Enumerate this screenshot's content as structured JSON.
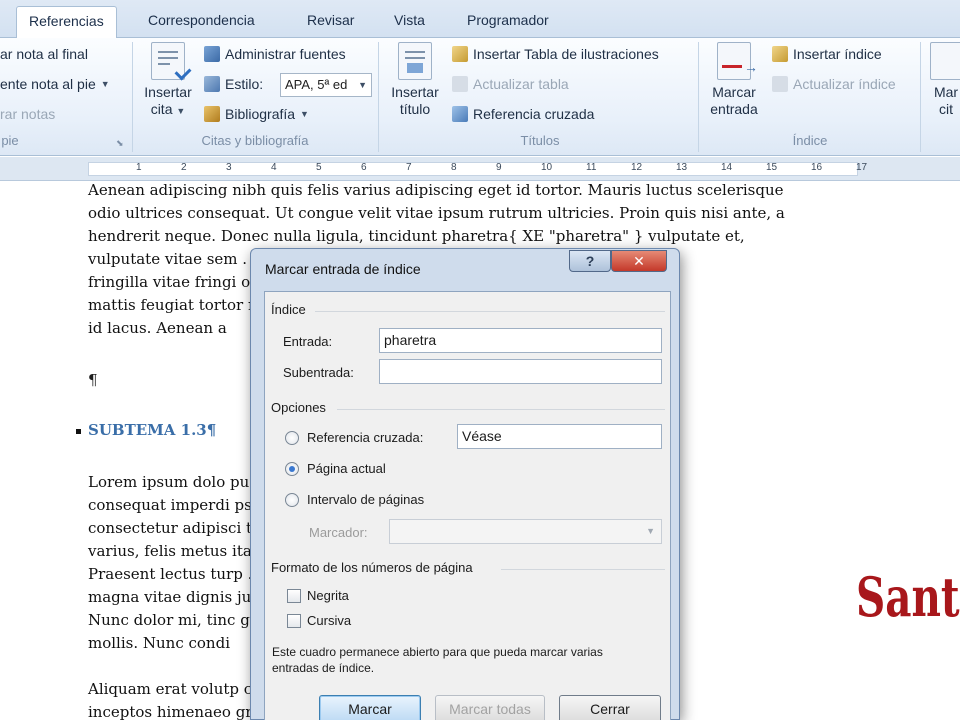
{
  "ribbon": {
    "tabs": [
      "Referencias",
      "Correspondencia",
      "Revisar",
      "Vista",
      "Programador"
    ],
    "active_tab": "Referencias",
    "footnotes": {
      "insert_endnote": "ar nota al final",
      "next_footnote": "ente nota al pie",
      "show_notes": "rar notas",
      "group_label": "pie"
    },
    "citations": {
      "insert_citation": "Insertar cita",
      "manage_sources": "Administrar fuentes",
      "style_label": "Estilo:",
      "style_value": "APA, 5ª ed",
      "bibliography": "Bibliografía",
      "group_label": "Citas y bibliografía"
    },
    "captions": {
      "insert_caption": "Insertar título",
      "insert_table_of_figures": "Insertar Tabla de ilustraciones",
      "update_table": "Actualizar tabla",
      "cross_reference": "Referencia cruzada",
      "group_label": "Títulos"
    },
    "index": {
      "mark_entry": "Marcar entrada",
      "insert_index": "Insertar índice",
      "update_index": "Actualizar índice",
      "group_label": "Índice"
    },
    "mark_citation_partial": "Mar cit"
  },
  "ruler": {
    "numbers": [
      "1",
      "2",
      "3",
      "4",
      "5",
      "6",
      "7",
      "8",
      "9",
      "10",
      "11",
      "12",
      "13",
      "14",
      "15",
      "16",
      "17"
    ]
  },
  "document": {
    "lines_top": [
      "Aenean adipiscing nibh quis felis varius adipiscing eget id tortor. Mauris luctus scelerisque",
      "odio ultrices consequat. Ut congue velit vitae ipsum rutrum ultricies. Proin quis nisi ante, a",
      "hendrerit neque. Donec nulla ligula, tincidunt pharetra{ XE \"pharetra\" } vulputate et,",
      "vulputate vitae sem                                             . Nulla risus justo,",
      "fringilla vitae fringi                                           odo adipiscing enim,",
      "mattis feugiat tortor                                            modo lacinia cursus",
      "id lacus. Aenean a"
    ],
    "pilcrow": "¶",
    "heading": "SUBTEMA 1.3¶",
    "lines_bottom": [
      "Lorem ipsum dolo                                                pus risus vel magna",
      "consequat imperdi                                               psum dolor sit amet,",
      "consectetur adipisci                                             tor, diam et porttitor",
      "varius, felis metus                                              itae tincidunt libero.",
      "Praesent lectus turp                                              . Donec dignissim,",
      "magna vitae dignis                                               justo velit ut lacus.",
      "Nunc dolor mi, tinc                                              gue ut turpis pretium",
      "mollis. Nunc condi",
      "",
      "Aliquam erat volutp                                             conubia nostra, per",
      "inceptos himenaeo                                               gravida velit at"
    ]
  },
  "watermark": "Santo",
  "dialog": {
    "title": "Marcar entrada de índice",
    "help_glyph": "?",
    "close_glyph": "✕",
    "index_section": "Índice",
    "entry_label": "Entrada:",
    "entry_value": "pharetra",
    "subentry_label": "Subentrada:",
    "subentry_value": "",
    "options_section": "Opciones",
    "cross_reference_label": "Referencia cruzada:",
    "cross_reference_value": "Véase",
    "current_page_label": "Página actual",
    "page_range_label": "Intervalo de páginas",
    "bookmark_label": "Marcador:",
    "page_format_section": "Formato de los números de página",
    "bold_label": "Negrita",
    "italic_label": "Cursiva",
    "note": "Este cuadro permanece abierto para que pueda marcar varias entradas de índice.",
    "mark_button": "Marcar",
    "mark_all_button": "Marcar todas",
    "close_button": "Cerrar",
    "selected_option": "current_page"
  }
}
